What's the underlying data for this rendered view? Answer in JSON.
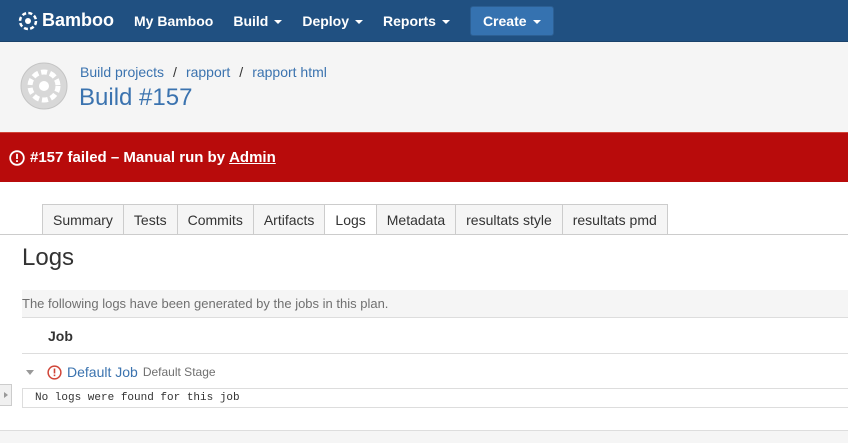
{
  "nav": {
    "logo_text": "Bamboo",
    "items": [
      {
        "label": "My Bamboo",
        "caret": false
      },
      {
        "label": "Build",
        "caret": true
      },
      {
        "label": "Deploy",
        "caret": true
      },
      {
        "label": "Reports",
        "caret": true
      }
    ],
    "create_label": "Create"
  },
  "header": {
    "breadcrumb": [
      "Build projects",
      "rapport",
      "rapport html"
    ],
    "separator": "/",
    "title": "Build #157",
    "icon": "plan-avatar-icon"
  },
  "banner": {
    "text": "#157 failed – Manual run by",
    "user": "Admin",
    "color": "#b80b0b",
    "icon": "error-circle-icon"
  },
  "tabs": {
    "items": [
      "Summary",
      "Tests",
      "Commits",
      "Artifacts",
      "Logs",
      "Metadata",
      "resultats style",
      "resultats pmd"
    ],
    "active": "Logs"
  },
  "logs": {
    "heading": "Logs",
    "description": "The following logs have been generated by the jobs in this plan.",
    "column_header": "Job",
    "job": {
      "name": "Default Job",
      "stage": "Default Stage",
      "status_icon": "error-circle-icon",
      "status_color": "#d04437",
      "log_text": "No logs were found for this job"
    }
  },
  "colors": {
    "nav_bg": "#205081",
    "link": "#3b73af",
    "create_bg": "#3572b0"
  }
}
